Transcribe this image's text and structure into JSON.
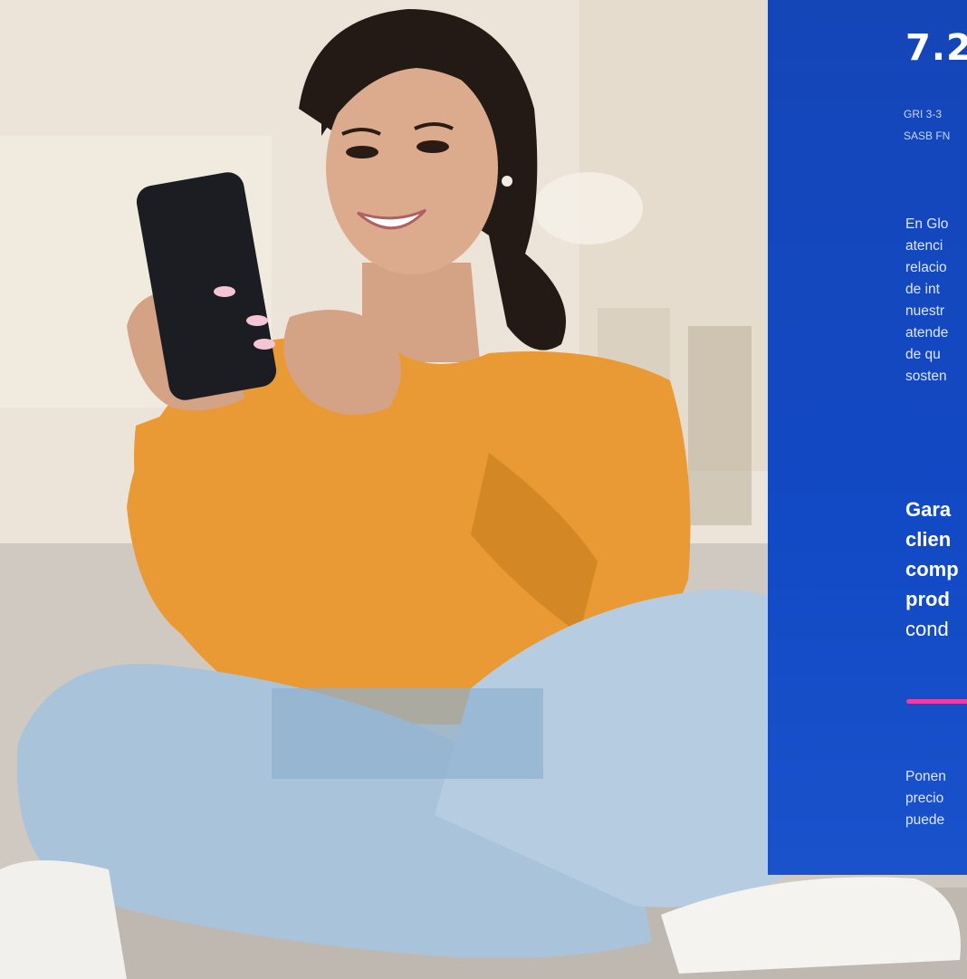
{
  "section": {
    "number": "7.2"
  },
  "references": {
    "line1": "GRI 3-3",
    "line2": "SASB FN"
  },
  "intro_lines": [
    "En Glo",
    "atenci",
    "relacio",
    "de int",
    "nuestr",
    "atende",
    "de qu",
    "sosten"
  ],
  "highlight_lines": [
    {
      "text": "Gara",
      "bold": true
    },
    {
      "text": "clien",
      "bold": true
    },
    {
      "text": "comp",
      "bold": true
    },
    {
      "text": "prod",
      "bold": true
    },
    {
      "text": "cond",
      "bold": false
    }
  ],
  "closing_lines": [
    "Ponen",
    "precio",
    "puede"
  ],
  "colors": {
    "panel": "#1249c4",
    "accent": "#ee3da6",
    "sweater": "#e99a34",
    "jeans": "#a9c3da"
  },
  "photo": {
    "subject": "woman-using-phone-icon"
  }
}
